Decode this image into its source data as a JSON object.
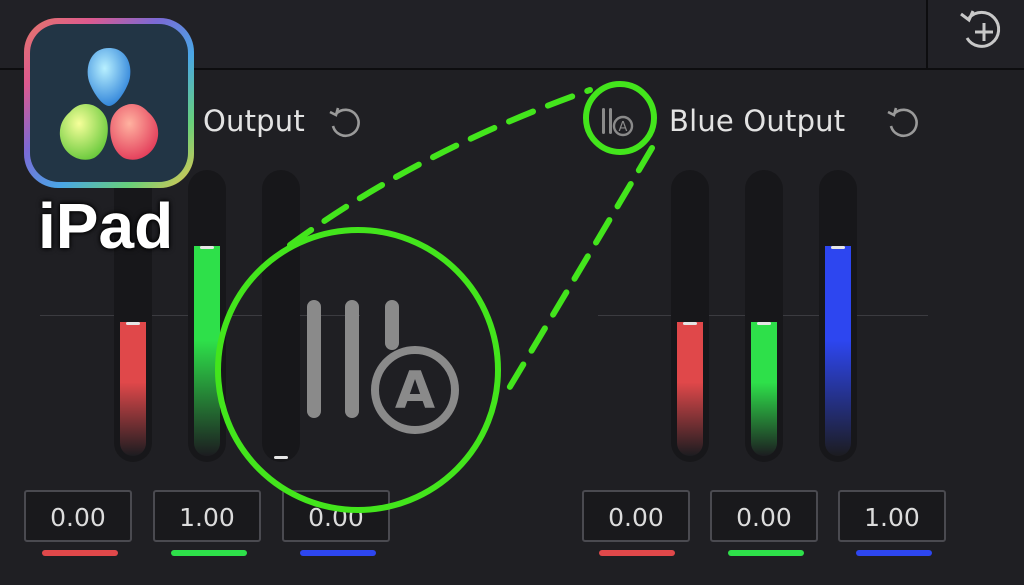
{
  "panels": [
    {
      "title": "Output",
      "values": [
        "0.00",
        "1.00",
        "0.00"
      ],
      "levels": [
        0.48,
        0.75,
        0.0
      ]
    },
    {
      "title": "Blue Output",
      "values": [
        "0.00",
        "0.00",
        "1.00"
      ],
      "levels": [
        0.48,
        0.48,
        0.75
      ]
    }
  ],
  "channels": [
    "red",
    "green",
    "blue"
  ],
  "colors": {
    "red": "#e0484a",
    "green": "#2ee04a",
    "blue": "#2d46f0",
    "highlight": "#43e51c"
  },
  "badge": {
    "text": "iPad",
    "icon": "davinci-resolve-icon"
  },
  "highlight_icon": "auto-balance-icon",
  "highlight_letter": "A"
}
